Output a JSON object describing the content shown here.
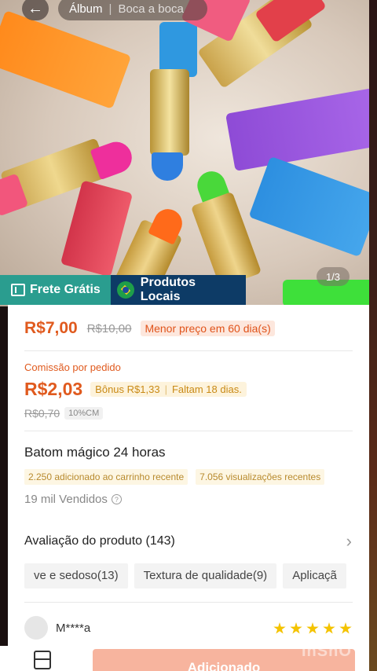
{
  "header": {
    "back_icon": "back-arrow-icon",
    "breadcrumb_album": "Álbum",
    "breadcrumb_separator": "|",
    "breadcrumb_source": "Boca a boca"
  },
  "gallery": {
    "counter": "1/3"
  },
  "tags": {
    "frete": "Frete Grátis",
    "frete_icon": "shipping-icon",
    "local": "Produtos Locais",
    "local_icon": "brazil-flag-icon"
  },
  "pricing": {
    "price": "R$7,00",
    "original_price": "R$10,00",
    "lowest_badge": "Menor preço em 60 dia(s)"
  },
  "commission": {
    "label": "Comissão por pedido",
    "amount": "R$2,03",
    "bonus": "Bônus R$1,33",
    "remaining": "Faltam 18 dias.",
    "old_amount": "R$0,70",
    "rate": "10%CM"
  },
  "product": {
    "title": "Batom mágico 24 horas",
    "cart_stat": "2.250 adicionado ao carrinho recente",
    "views_stat": "7.056 visualizações recentes",
    "sold": "19 mil Vendidos"
  },
  "reviews": {
    "title": "Avaliação do produto (143)",
    "chips": [
      "ve e sedoso(13)",
      "Textura de qualidade(9)",
      "Aplicaçã"
    ],
    "reviewer": "M****a",
    "rating": 5
  },
  "bottom": {
    "added_label": "Adicionado",
    "watermark": "InShO"
  }
}
